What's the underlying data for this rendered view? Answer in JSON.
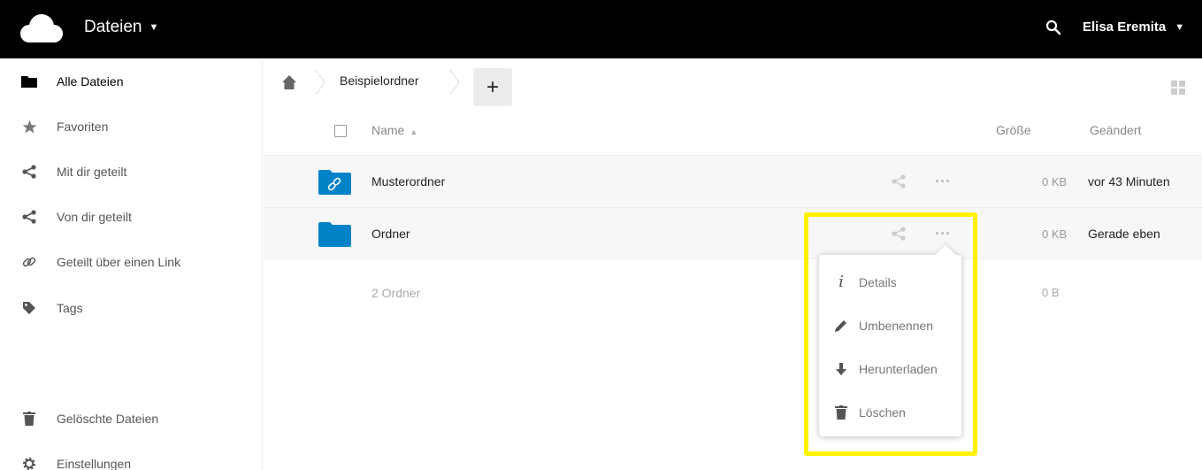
{
  "header": {
    "app_name": "Dateien",
    "user_name": "Elisa Eremita",
    "logo_icon": "cloud-icon",
    "search_icon": "search-icon",
    "background_color": "#000000"
  },
  "sidebar": {
    "items": [
      {
        "label": "Alle Dateien",
        "icon": "folder-icon"
      },
      {
        "label": "Favoriten",
        "icon": "star-icon"
      },
      {
        "label": "Mit dir geteilt",
        "icon": "share-icon"
      },
      {
        "label": "Von dir geteilt",
        "icon": "share-icon"
      },
      {
        "label": "Geteilt über einen Link",
        "icon": "link-icon"
      },
      {
        "label": "Tags",
        "icon": "tag-icon"
      }
    ],
    "bottom_items": [
      {
        "label": "Gelöschte Dateien",
        "icon": "trash-icon"
      },
      {
        "label": "Einstellungen",
        "icon": "gear-icon"
      }
    ]
  },
  "breadcrumb": {
    "folder": "Beispielordner",
    "new_button": "+"
  },
  "table": {
    "headers": {
      "name": "Name",
      "size": "Größe",
      "modified": "Geändert"
    },
    "rows": [
      {
        "name": "Musterordner",
        "size": "0 KB",
        "modified": "vor 43 Minuten",
        "icon": "shared-folder-link-icon"
      },
      {
        "name": "Ordner",
        "size": "0 KB",
        "modified": "Gerade eben",
        "icon": "folder-icon"
      }
    ],
    "summary": {
      "count": "2 Ordner",
      "size": "0 B"
    }
  },
  "context_menu": {
    "items": [
      {
        "label": "Details",
        "icon": "info-icon"
      },
      {
        "label": "Umbenennen",
        "icon": "pencil-icon"
      },
      {
        "label": "Herunterladen",
        "icon": "download-icon"
      },
      {
        "label": "Löschen",
        "icon": "trash-icon"
      }
    ]
  },
  "colors": {
    "folder_blue": "#0082c9",
    "highlight_yellow": "#fff200"
  }
}
